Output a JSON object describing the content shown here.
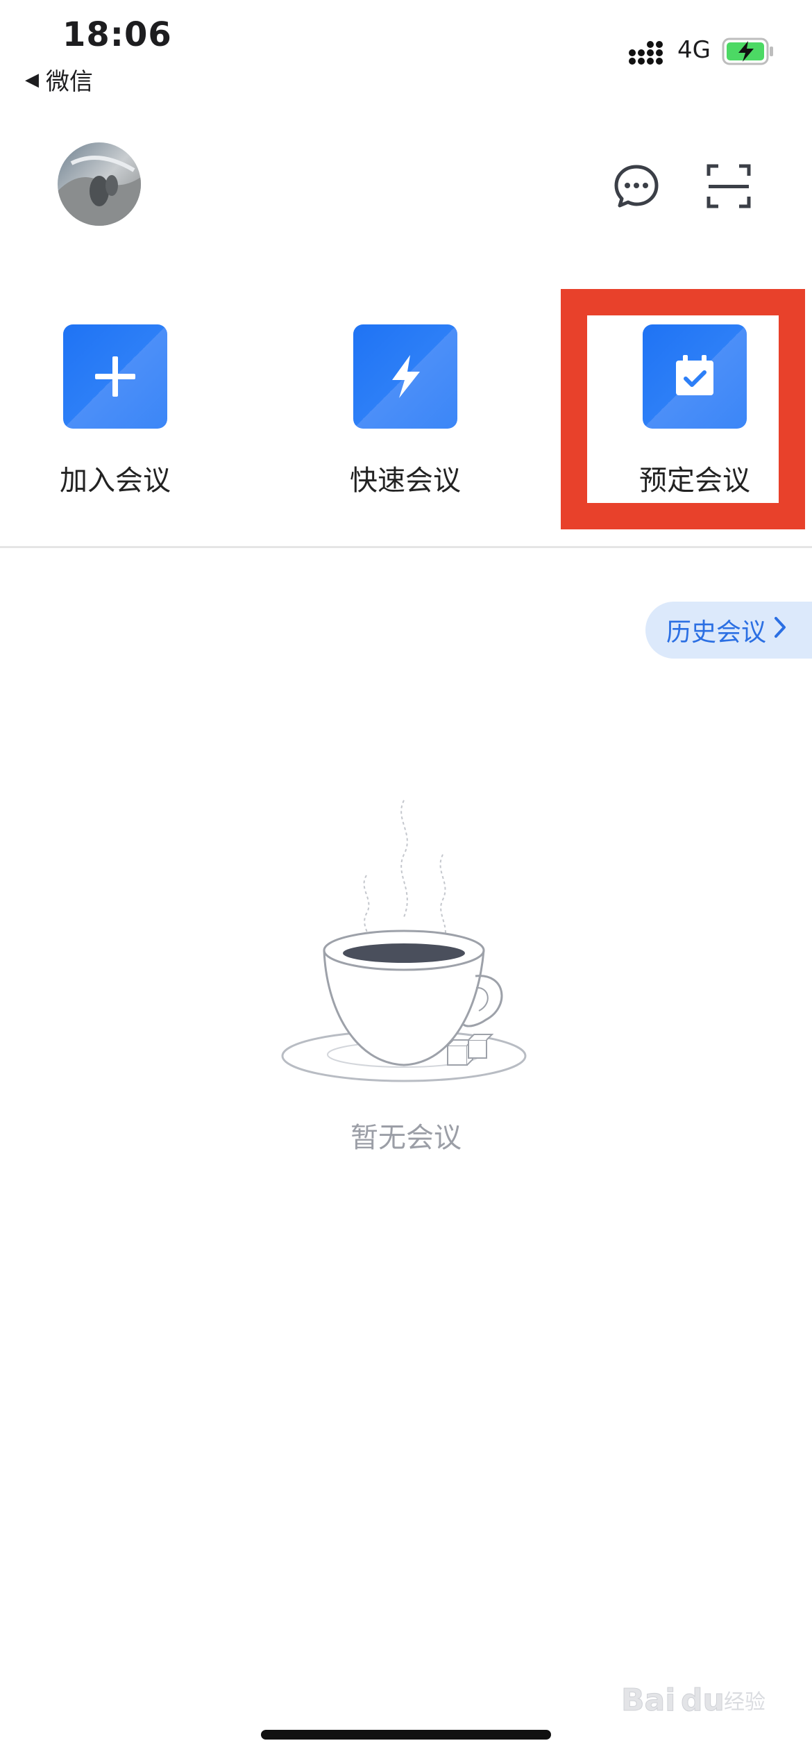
{
  "status_bar": {
    "time": "18:06",
    "back_app": "微信",
    "network": "4G",
    "icons": [
      "signal-icon",
      "battery-charging-icon"
    ]
  },
  "header": {
    "avatar": "user-avatar",
    "actions": [
      "message-icon",
      "scan-icon"
    ]
  },
  "actions": [
    {
      "label": "加入会议",
      "icon": "plus-icon"
    },
    {
      "label": "快速会议",
      "icon": "lightning-icon"
    },
    {
      "label": "预定会议",
      "icon": "calendar-check-icon"
    }
  ],
  "history": {
    "label": "历史会议",
    "icon": "chevron-right-icon"
  },
  "empty_state": {
    "text": "暂无会议",
    "illustration": "coffee-cup-icon"
  },
  "watermark": {
    "text": "Baidu经验"
  },
  "colors": {
    "accent": "#2d7ff7",
    "highlight": "#e8412b",
    "history_bg": "#dce9fb",
    "muted_text": "#9b9ea6"
  }
}
